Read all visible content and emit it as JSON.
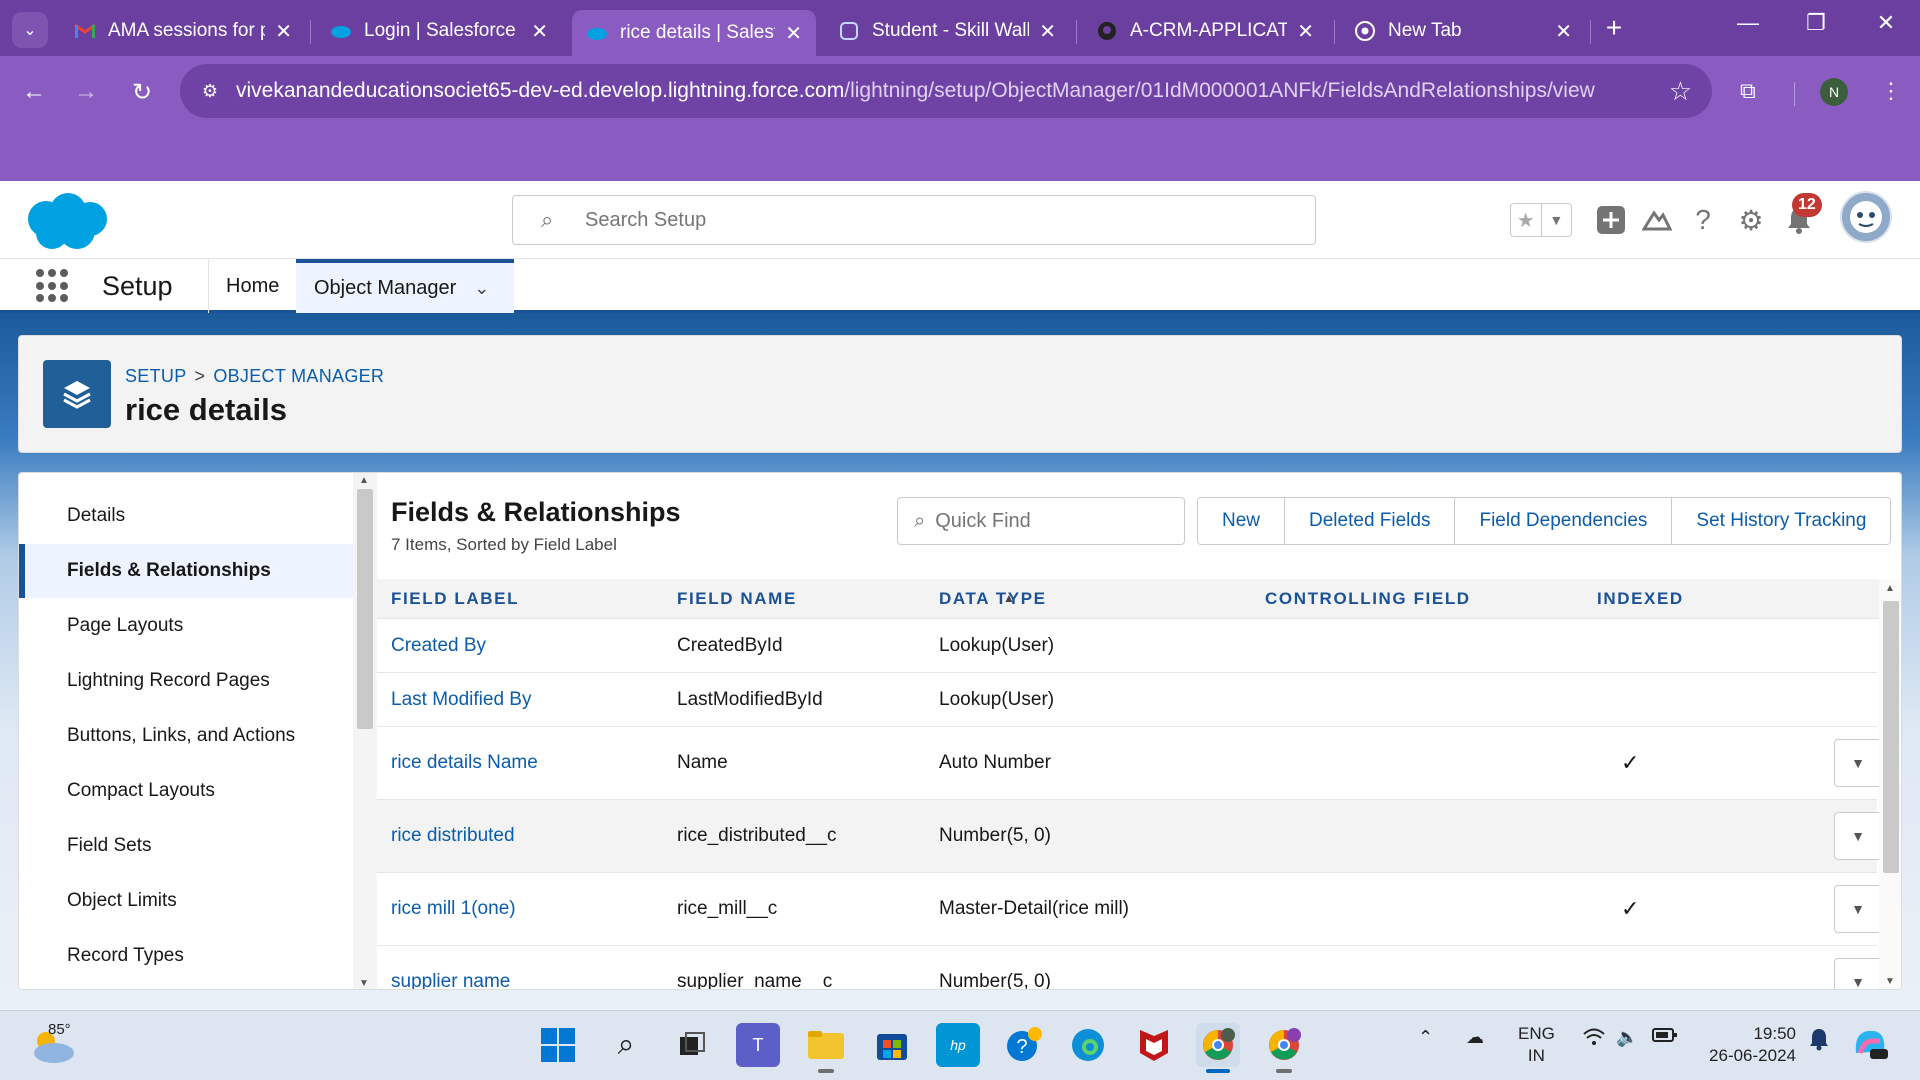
{
  "browser": {
    "tabs": [
      {
        "title": "AMA sessions for p",
        "icon": "gmail-icon"
      },
      {
        "title": "Login | Salesforce",
        "icon": "salesforce-icon"
      },
      {
        "title": "rice details | Salesf",
        "icon": "salesforce-icon",
        "active": true
      },
      {
        "title": "Student - Skill Wall",
        "icon": "skillwallet-icon"
      },
      {
        "title": "A-CRM-APPLICATI",
        "icon": "github-icon"
      },
      {
        "title": "New Tab",
        "icon": "chrome-icon"
      }
    ],
    "url_host": "vivekanandeducationsociet65-dev-ed.develop.lightning.force.com",
    "url_path": "/lightning/setup/ObjectManager/01IdM000001ANFk/FieldsAndRelationships/view",
    "profile_initial": "N"
  },
  "sf_header": {
    "search_placeholder": "Search Setup",
    "notification_count": "12"
  },
  "sf_nav": {
    "app_name": "Setup",
    "items": [
      "Home",
      "Object Manager"
    ]
  },
  "object_header": {
    "breadcrumb": [
      "SETUP",
      "OBJECT MANAGER"
    ],
    "title": "rice details"
  },
  "left_nav": {
    "items": [
      "Details",
      "Fields & Relationships",
      "Page Layouts",
      "Lightning Record Pages",
      "Buttons, Links, and Actions",
      "Compact Layouts",
      "Field Sets",
      "Object Limits",
      "Record Types"
    ],
    "active": "Fields & Relationships"
  },
  "fields_panel": {
    "title": "Fields & Relationships",
    "subtitle": "7 Items, Sorted by Field Label",
    "quickfind_placeholder": "Quick Find",
    "buttons": [
      "New",
      "Deleted Fields",
      "Field Dependencies",
      "Set History Tracking"
    ],
    "columns": [
      "FIELD LABEL",
      "FIELD NAME",
      "DATA TYPE",
      "CONTROLLING FIELD",
      "INDEXED"
    ],
    "rows": [
      {
        "label": "Created By",
        "name": "CreatedById",
        "type": "Lookup(User)",
        "controlling": "",
        "indexed": false,
        "menu": false
      },
      {
        "label": "Last Modified By",
        "name": "LastModifiedById",
        "type": "Lookup(User)",
        "controlling": "",
        "indexed": false,
        "menu": false
      },
      {
        "label": "rice details Name",
        "name": "Name",
        "type": "Auto Number",
        "controlling": "",
        "indexed": true,
        "menu": true
      },
      {
        "label": "rice distributed",
        "name": "rice_distributed__c",
        "type": "Number(5, 0)",
        "controlling": "",
        "indexed": false,
        "menu": true
      },
      {
        "label": "rice mill 1(one)",
        "name": "rice_mill__c",
        "type": "Master-Detail(rice mill)",
        "controlling": "",
        "indexed": true,
        "menu": true
      },
      {
        "label": "supplier name",
        "name": "supplier_name__c",
        "type": "Number(5, 0)",
        "controlling": "",
        "indexed": false,
        "menu": true
      }
    ]
  },
  "taskbar": {
    "weather_temp": "85°",
    "lang_line1": "ENG",
    "lang_line2": "IN",
    "time": "19:50",
    "date": "26-06-2024"
  },
  "colors": {
    "browser_tabbar": "#6b3fa0",
    "browser_toolbar": "#8a5cc2",
    "sf_brand_blue": "#1b5297",
    "link_blue": "#0b5cab",
    "notification_red": "#c23934"
  }
}
